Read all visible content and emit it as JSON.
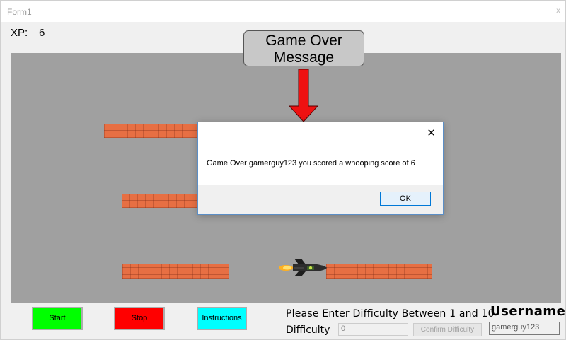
{
  "window": {
    "title": "Form1",
    "close_glyph": "x"
  },
  "hud": {
    "xp_label": "XP:",
    "xp_value": "6"
  },
  "callout": {
    "line1": "Game Over",
    "line2": "Message"
  },
  "dialog": {
    "message": "Game Over gamerguy123 you scored a whooping score of 6",
    "ok_label": "OK",
    "close_glyph": "✕"
  },
  "controls": {
    "start_label": "Start",
    "stop_label": "Stop",
    "instructions_label": "Instructions",
    "difficulty_prompt": "Please Enter Difficulty Between 1 and 10",
    "difficulty_label": "Difficulty",
    "difficulty_value": "0",
    "confirm_label": "Confirm Difficulty",
    "username_label": "Username",
    "username_value": "gamerguy123"
  },
  "colors": {
    "game_bg": "#a0a0a0",
    "brick": "#e76f43",
    "start": "#00ff00",
    "stop": "#ff0000",
    "instructions": "#00ffff",
    "arrow": "#ee1111",
    "callout_bg": "#c8c8c8"
  },
  "icons": {
    "rocket": "rocket-icon",
    "arrow": "down-arrow-icon"
  }
}
